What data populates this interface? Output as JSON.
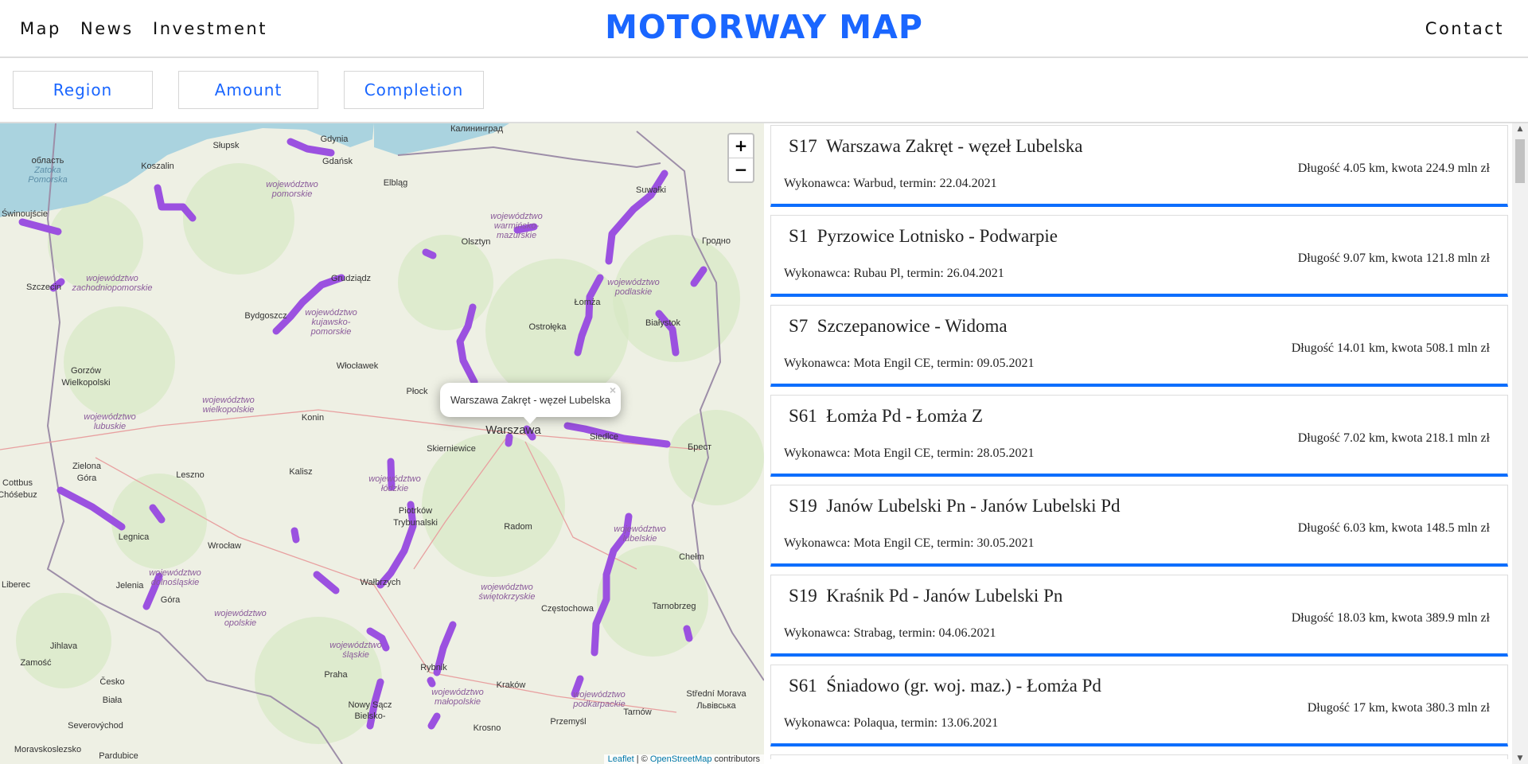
{
  "header": {
    "nav": [
      "Map",
      "News",
      "Investment"
    ],
    "title": "MOTORWAY MAP",
    "contact": "Contact"
  },
  "filters": [
    "Region",
    "Amount",
    "Completion"
  ],
  "map": {
    "zoom_in": "+",
    "zoom_out": "−",
    "popup": {
      "text": "Warszawa Zakręt - węzeł Lubelska",
      "close": "×"
    },
    "attribution": {
      "leaflet": "Leaflet",
      "sep": " | © ",
      "osm": "OpenStreetMap",
      "rest": " contributors"
    },
    "route_color": "#9b51e0",
    "water_color": "#aad3df",
    "cities": [
      "Słupsk",
      "Gdynia",
      "Gdańsk",
      "Калининград",
      "Elbląg",
      "Koszalin",
      "Świnoujście",
      "Szczecin",
      "Olsztyn",
      "Suwałki",
      "Гродно",
      "Bydgoszcz",
      "Grudziądz",
      "Ostrołęka",
      "Łomża",
      "Białystok",
      "Gorzów",
      "Wielkopolski",
      "Włocławek",
      "Płock",
      "Warszawa",
      "Konin",
      "Skierniewice",
      "Siedlce",
      "Брест",
      "Zielona",
      "Góra",
      "Leszno",
      "Kalisz",
      "Piotrków",
      "Trybunalski",
      "Radom",
      "Cottbus",
      "Chóśebuz",
      "Legnica",
      "Wrocław",
      "Chełm",
      "Liberec",
      "Jelenia",
      "Góra",
      "Wałbrzych",
      "Częstochowa",
      "Tarnobrzeg",
      "Zamość",
      "Praha",
      "Rybnik",
      "Kraków",
      "Tarnów",
      "Przemyśl",
      "Krosno",
      "Nowy Sącz",
      "Bielsko-",
      "Biała",
      "Česko",
      "Pardubice",
      "Jihlava",
      "Severovýchod",
      "Moravskoslezsko",
      "Střední Morava",
      "Львівська",
      "область",
      "Zatoka",
      "Pomorska"
    ],
    "regions": [
      "województwo",
      "pomorskie",
      "województwo",
      "warmińsko-",
      "mazurskie",
      "województwo",
      "zachodniopomorskie",
      "województwo",
      "kujawsko-",
      "pomorskie",
      "województwo",
      "podlaskie",
      "województwo",
      "wielkopolskie",
      "województwo",
      "lubuskie",
      "województwo",
      "łódzkie",
      "województwo",
      "lubelskie",
      "województwo",
      "dolnośląskie",
      "województwo",
      "opolskie",
      "województwo",
      "świętokrzyskie",
      "województwo",
      "śląskie",
      "województwo",
      "małopolskie",
      "województwo",
      "podkarpackie"
    ]
  },
  "projects": [
    {
      "road": "S17",
      "name": "Warszawa Zakręt - węzeł Lubelska",
      "detail": "Długość 4.05 km, kwota 224.9 mln zł",
      "contractor": "Wykonawca: Warbud, termin: 22.04.2021"
    },
    {
      "road": "S1",
      "name": "Pyrzowice Lotnisko - Podwarpie",
      "detail": "Długość 9.07 km, kwota 121.8 mln zł",
      "contractor": "Wykonawca: Rubau Pl, termin: 26.04.2021"
    },
    {
      "road": "S7",
      "name": "Szczepanowice - Widoma",
      "detail": "Długość 14.01 km, kwota 508.1 mln zł",
      "contractor": "Wykonawca: Mota Engil CE, termin: 09.05.2021"
    },
    {
      "road": "S61",
      "name": "Łomża Pd - Łomża Z",
      "detail": "Długość 7.02 km, kwota 218.1 mln zł",
      "contractor": "Wykonawca: Mota Engil CE, termin: 28.05.2021"
    },
    {
      "road": "S19",
      "name": "Janów Lubelski Pn - Janów Lubelski Pd",
      "detail": "Długość 6.03 km, kwota 148.5 mln zł",
      "contractor": "Wykonawca: Mota Engil CE, termin: 30.05.2021"
    },
    {
      "road": "S19",
      "name": "Kraśnik Pd - Janów Lubelski Pn",
      "detail": "Długość 18.03 km, kwota 389.9 mln zł",
      "contractor": "Wykonawca: Strabag, termin: 04.06.2021"
    },
    {
      "road": "S61",
      "name": "Śniadowo (gr. woj. maz.) - Łomża Pd",
      "detail": "Długość 17 km, kwota 380.3 mln zł",
      "contractor": "Wykonawca: Polaqua, termin: 13.06.2021"
    }
  ]
}
